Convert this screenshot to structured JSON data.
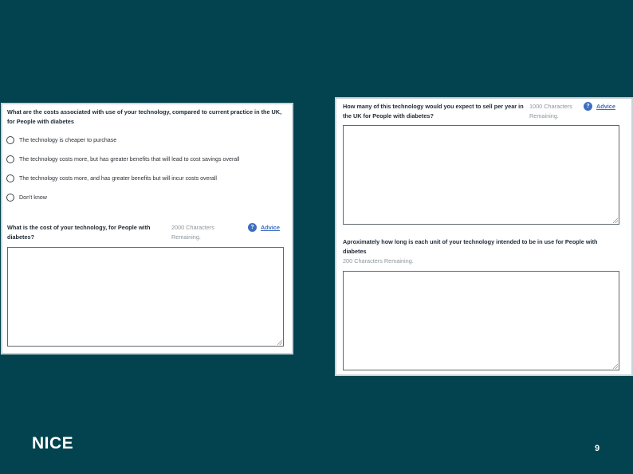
{
  "left_panel": {
    "question1": "What are the costs associated with use of your technology, compared to current practice in the UK, for People with diabetes",
    "options": [
      "The technology is cheaper to purchase",
      "The technology costs more, but has greater benefits that will lead to cost savings overall",
      "The technology costs more, and has greater benefits but will incur costs overall",
      "Don't know"
    ],
    "question2": "What is the cost of your technology, for People with diabetes?",
    "chars_remaining": "2000 Characters Remaining.",
    "advice_label": "Advice",
    "help_glyph": "?"
  },
  "right_panel": {
    "question1": "How many of this technology would you expect to sell per year in the UK for People with diabetes?",
    "chars_remaining1": "1000 Characters Remaining.",
    "advice_label": "Advice",
    "help_glyph": "?",
    "question2": "Aproximately how long is each unit of your technology intended to be in use for People with diabetes",
    "chars_remaining2": "200 Characters Remaining."
  },
  "footer": {
    "logo": "NICE",
    "page_number": "9"
  },
  "colors": {
    "background": "#02434f",
    "panel": "#ffffff",
    "link": "#3d6ec1"
  }
}
